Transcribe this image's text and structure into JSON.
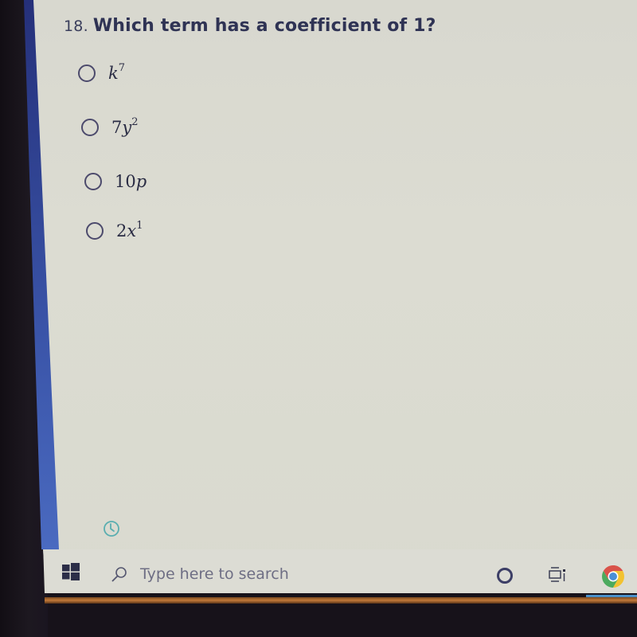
{
  "question": {
    "number": "18.",
    "text": "Which term has a coefficient of 1?"
  },
  "options": [
    {
      "coef": "",
      "var": "k",
      "exp": "7",
      "selected": false
    },
    {
      "coef": "7",
      "var": "y",
      "exp": "2",
      "selected": false
    },
    {
      "coef": "10",
      "var": "p",
      "exp": "",
      "selected": false
    },
    {
      "coef": "2",
      "var": "x",
      "exp": "1",
      "selected": false
    }
  ],
  "icons": {
    "timer": "clock-icon",
    "start": "windows-icon",
    "search": "search-icon",
    "cortana": "cortana-icon",
    "task_view": "task-view-icon",
    "browser": "chrome-icon"
  },
  "taskbar": {
    "search_placeholder": "Type here to search"
  },
  "colors": {
    "question_text": "#2f3354",
    "accent_blue": "#3a54a8",
    "timer_teal": "#5aaeb0",
    "taskbar_bg": "#dcdcd4"
  }
}
